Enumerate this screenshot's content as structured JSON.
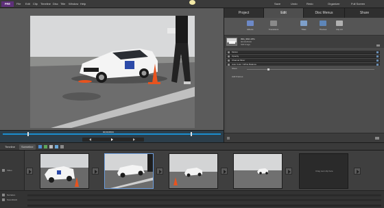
{
  "menubar": {
    "logo": "PRE",
    "items": [
      "File",
      "Edit",
      "Clip",
      "Timeline",
      "Disc",
      "Title",
      "Window",
      "Help"
    ],
    "toolbar": [
      "Save",
      "Undo",
      "Redo",
      "Organizer",
      "Full Screen"
    ]
  },
  "tabs": {
    "main": [
      "Project",
      "Edit",
      "Disc Menus",
      "Share"
    ],
    "sub": [
      "Effects",
      "Transitions",
      "Titles",
      "Themes",
      "Clip Art"
    ]
  },
  "clip": {
    "name": "IMG_9621.JPG",
    "line2": "00:00:05:00",
    "line3": "Still Image"
  },
  "effects": [
    "Motion",
    "Opacity",
    "Channel Mixer",
    "Auto Color / White Balance"
  ],
  "props": {
    "row1": "Show",
    "row2": "Add Frames"
  },
  "scrubber": {
    "timecode": "00;00;08;04"
  },
  "timeline": {
    "tabs": [
      "Timeline",
      "Sceneline"
    ],
    "track_label": "Video",
    "clips_count_visible": 4,
    "drop_target": "Drag next clip here",
    "lower_labels": [
      "Narration",
      "Soundtrack"
    ]
  },
  "colors": {
    "accent": "#6ea0e0",
    "cone": "#e8531e",
    "car": "#f2f2f2",
    "sky": "#d9dadb",
    "track": "#6c6c6c"
  }
}
